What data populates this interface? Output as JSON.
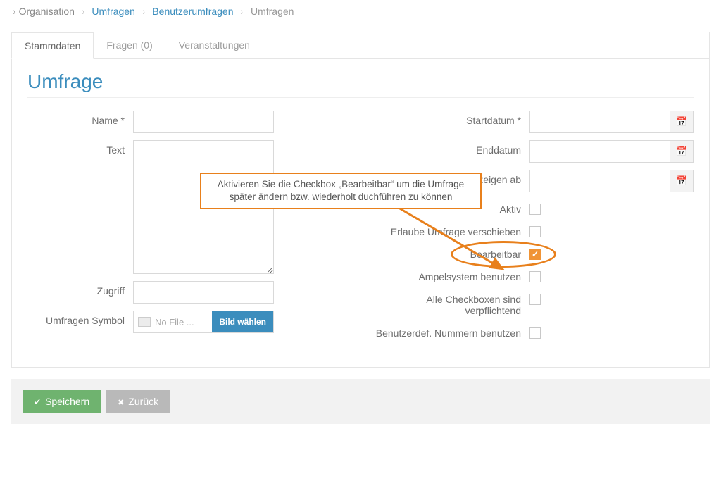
{
  "breadcrumb": {
    "root_icon": "›",
    "items": [
      {
        "label": "Organisation",
        "link": false
      },
      {
        "label": "Umfragen",
        "link": true
      },
      {
        "label": "Benutzerumfragen",
        "link": true
      },
      {
        "label": "Umfragen",
        "link": false
      }
    ]
  },
  "tabs": [
    {
      "label": "Stammdaten",
      "active": true
    },
    {
      "label": "Fragen (0)",
      "active": false
    },
    {
      "label": "Veranstaltungen",
      "active": false
    }
  ],
  "page_title": "Umfrage",
  "left": {
    "name_label": "Name *",
    "text_label": "Text",
    "access_label": "Zugriff",
    "symbol_label": "Umfragen Symbol",
    "file_placeholder": "No File ...",
    "file_button": "Bild wählen"
  },
  "right": {
    "start_label": "Startdatum *",
    "end_label": "Enddatum",
    "show_from_label": "zeigen ab",
    "active_label": "Aktiv",
    "allow_move_label": "Erlaube Umfrage verschieben",
    "editable_label": "Bearbeitbar",
    "traffic_label": "Ampelsystem benutzen",
    "all_cb_label": "Alle Checkboxen sind verpflichtend",
    "usernum_label": "Benutzerdef. Nummern benutzen",
    "editable_checked": true
  },
  "callout": {
    "text": "Aktivieren Sie die Checkbox „Bearbeitbar“ um die Umfrage später ändern bzw. wiederholt duchführen zu können"
  },
  "actions": {
    "save": "Speichern",
    "back": "Zurück"
  }
}
